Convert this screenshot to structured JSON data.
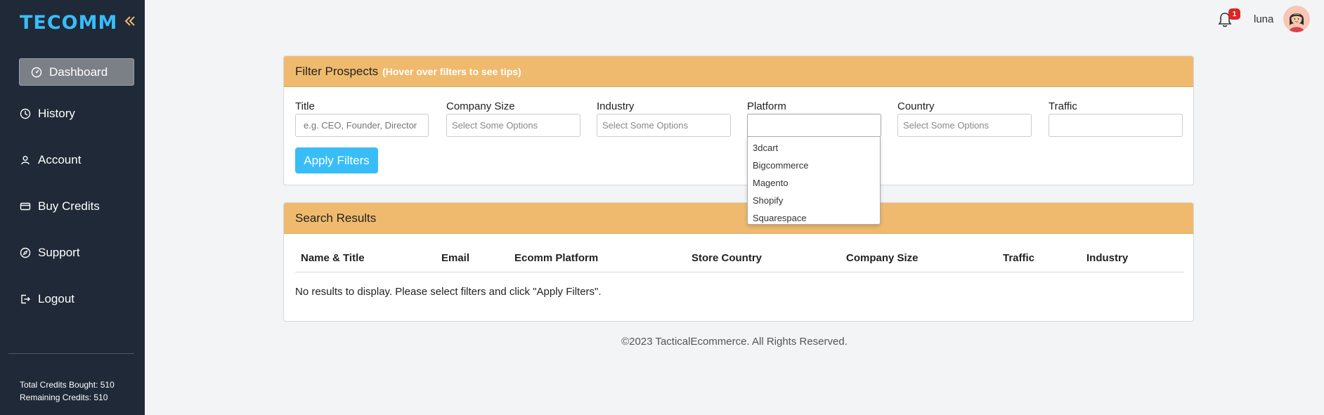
{
  "brand": {
    "logo_text": "TECOMM",
    "accent": "#38bdf8",
    "sidebar_bg": "#1f2937",
    "header_bg": "#f0ba6e"
  },
  "sidebar": {
    "dashboard_label": "Dashboard",
    "items": [
      {
        "label": "History",
        "icon": "clock-icon"
      },
      {
        "label": "Account",
        "icon": "user-icon"
      },
      {
        "label": "Buy Credits",
        "icon": "credit-card-icon"
      },
      {
        "label": "Support",
        "icon": "compass-icon"
      },
      {
        "label": "Logout",
        "icon": "logout-icon"
      }
    ],
    "total_credits": "Total Credits Bought: 510",
    "remaining_credits": "Remaining Credits: 510"
  },
  "header": {
    "notification_count": "1",
    "username": "luna"
  },
  "filter_card": {
    "title": "Filter Prospects",
    "hint": "(Hover over filters to see tips)",
    "fields": [
      {
        "label": "Title",
        "placeholder": "e.g. CEO, Founder, Director"
      },
      {
        "label": "Company Size",
        "placeholder": "Select Some Options"
      },
      {
        "label": "Industry",
        "placeholder": "Select Some Options"
      },
      {
        "label": "Platform",
        "placeholder": ""
      },
      {
        "label": "Country",
        "placeholder": "Select Some Options"
      },
      {
        "label": "Traffic",
        "placeholder": ""
      }
    ],
    "apply_label": "Apply Filters",
    "platform_options": [
      "3dcart",
      "Bigcommerce",
      "Magento",
      "Shopify",
      "Squarespace"
    ]
  },
  "results_card": {
    "title": "Search Results",
    "columns": [
      "Name & Title",
      "Email",
      "Ecomm Platform",
      "Store Country",
      "Company Size",
      "Traffic",
      "Industry"
    ],
    "empty_message": "No results to display. Please select filters and click \"Apply Filters\"."
  },
  "footer": {
    "text": "©2023 TacticalEcommerce. All Rights Reserved."
  }
}
